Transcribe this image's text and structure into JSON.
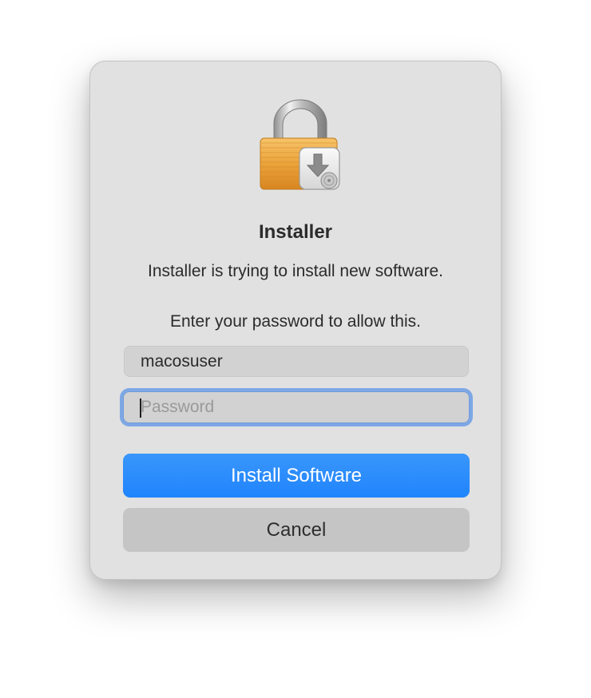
{
  "dialog": {
    "icon": "lock-with-installer-badge-icon",
    "title": "Installer",
    "message": "Installer is trying to install new software.",
    "prompt": "Enter your password to allow this.",
    "username": {
      "value": "macosuser"
    },
    "password": {
      "value": "",
      "placeholder": "Password"
    },
    "primary_button": "Install Software",
    "secondary_button": "Cancel"
  },
  "colors": {
    "accent": "#1f84fc",
    "focus_ring": "#7ea7e5",
    "dialog_bg": "#e1e1e1"
  }
}
